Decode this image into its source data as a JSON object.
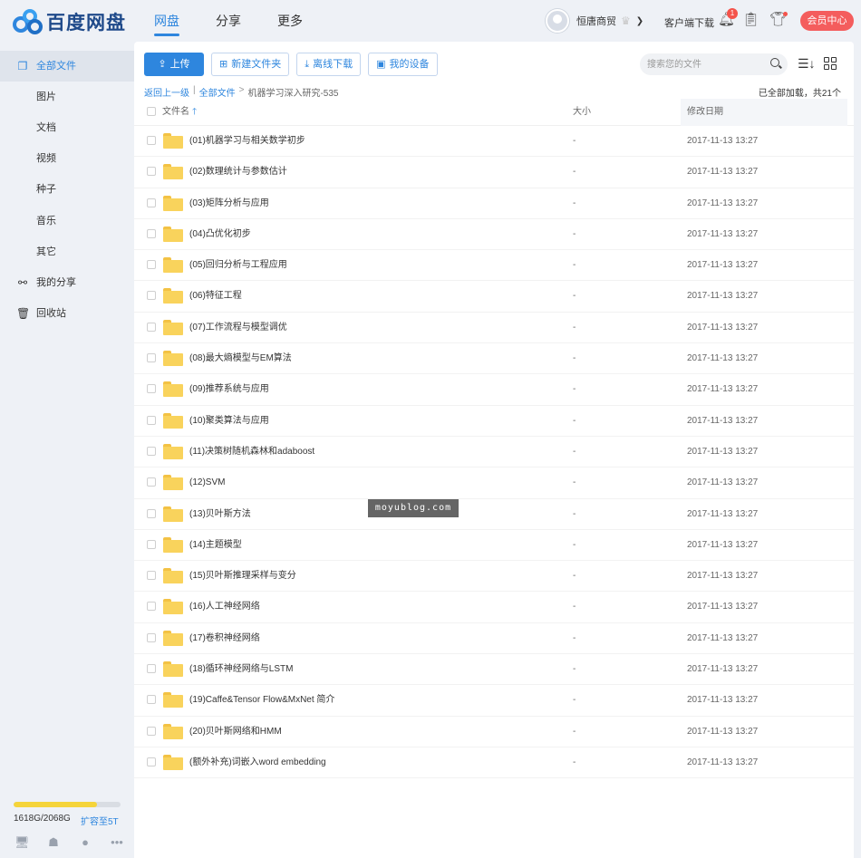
{
  "header": {
    "logo_text": "百度网盘",
    "nav": [
      {
        "label": "网盘",
        "active": true
      },
      {
        "label": "分享",
        "active": false
      },
      {
        "label": "更多",
        "active": false
      }
    ],
    "username": "恒唐商贸",
    "client_download": "客户端下载",
    "notification_count": "1",
    "vip_button": "会员中心"
  },
  "sidebar": {
    "items": [
      {
        "label": "全部文件",
        "icon": "document-icon",
        "active": true
      },
      {
        "label": "图片"
      },
      {
        "label": "文档"
      },
      {
        "label": "视频"
      },
      {
        "label": "种子"
      },
      {
        "label": "音乐"
      },
      {
        "label": "其它"
      },
      {
        "label": "我的分享",
        "icon": "share-icon"
      },
      {
        "label": "回收站",
        "icon": "trash-icon"
      }
    ],
    "quota": {
      "used_fraction": 0.78,
      "text": "1618G/2068G",
      "expand": "扩容至5T"
    }
  },
  "toolbar": {
    "upload": "上传",
    "new_folder": "新建文件夹",
    "offline_download": "离线下载",
    "my_devices": "我的设备",
    "search_placeholder": "搜索您的文件"
  },
  "breadcrumb": {
    "back": "返回上一级",
    "all_files": "全部文件",
    "current": "机器学习深入研究-535",
    "loaded_text": "已全部加载，共21个"
  },
  "table": {
    "col_name": "文件名",
    "col_size": "大小",
    "col_date": "修改日期",
    "rows": [
      {
        "name": "(01)机器学习与相关数学初步",
        "size": "-",
        "date": "2017-11-13 13:27"
      },
      {
        "name": "(02)数理统计与参数估计",
        "size": "-",
        "date": "2017-11-13 13:27"
      },
      {
        "name": "(03)矩阵分析与应用",
        "size": "-",
        "date": "2017-11-13 13:27"
      },
      {
        "name": "(04)凸优化初步",
        "size": "-",
        "date": "2017-11-13 13:27"
      },
      {
        "name": "(05)回归分析与工程应用",
        "size": "-",
        "date": "2017-11-13 13:27"
      },
      {
        "name": "(06)特征工程",
        "size": "-",
        "date": "2017-11-13 13:27"
      },
      {
        "name": "(07)工作流程与模型调优",
        "size": "-",
        "date": "2017-11-13 13:27"
      },
      {
        "name": "(08)最大熵模型与EM算法",
        "size": "-",
        "date": "2017-11-13 13:27"
      },
      {
        "name": "(09)推荐系统与应用",
        "size": "-",
        "date": "2017-11-13 13:27"
      },
      {
        "name": "(10)聚类算法与应用",
        "size": "-",
        "date": "2017-11-13 13:27"
      },
      {
        "name": "(11)决策树随机森林和adaboost",
        "size": "-",
        "date": "2017-11-13 13:27"
      },
      {
        "name": "(12)SVM",
        "size": "-",
        "date": "2017-11-13 13:27"
      },
      {
        "name": "(13)贝叶斯方法",
        "size": "-",
        "date": "2017-11-13 13:27"
      },
      {
        "name": "(14)主题模型",
        "size": "-",
        "date": "2017-11-13 13:27"
      },
      {
        "name": "(15)贝叶斯推理采样与变分",
        "size": "-",
        "date": "2017-11-13 13:27"
      },
      {
        "name": "(16)人工神经网络",
        "size": "-",
        "date": "2017-11-13 13:27"
      },
      {
        "name": "(17)卷积神经网络",
        "size": "-",
        "date": "2017-11-13 13:27"
      },
      {
        "name": "(18)循环神经网络与LSTM",
        "size": "-",
        "date": "2017-11-13 13:27"
      },
      {
        "name": "(19)Caffe&Tensor Flow&MxNet 简介",
        "size": "-",
        "date": "2017-11-13 13:27"
      },
      {
        "name": "(20)贝叶斯网络和HMM",
        "size": "-",
        "date": "2017-11-13 13:27"
      },
      {
        "name": "(额外补充)词嵌入word embedding",
        "size": "-",
        "date": "2017-11-13 13:27"
      }
    ]
  },
  "watermark": "moyublog.com"
}
